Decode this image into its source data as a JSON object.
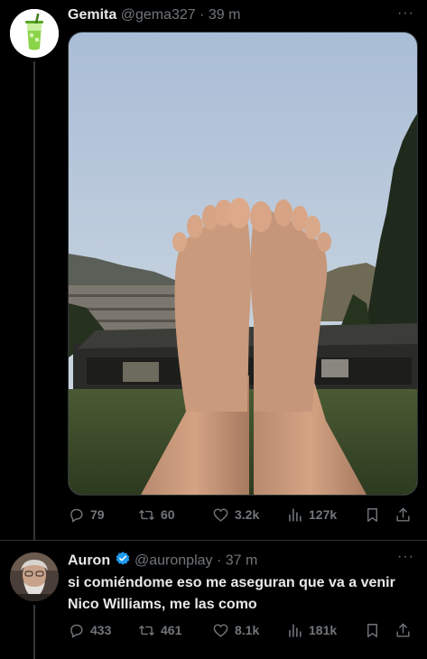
{
  "tweets": [
    {
      "name": "Gemita",
      "handle": "@gema327",
      "time": "· 39 m",
      "stats": {
        "replies": "79",
        "reposts": "60",
        "likes": "3.2k",
        "views": "127k"
      }
    },
    {
      "name": "Auron",
      "handle": "@auronplay",
      "time": "· 37 m",
      "text": "si comiéndome eso me aseguran que va a venir Nico Williams, me las como",
      "stats": {
        "replies": "433",
        "reposts": "461",
        "likes": "8.1k",
        "views": "181k"
      }
    }
  ],
  "colors": {
    "accent": "#1d9bf0",
    "muted": "#71767b",
    "text": "#e7e9ea",
    "bg": "#000000"
  }
}
